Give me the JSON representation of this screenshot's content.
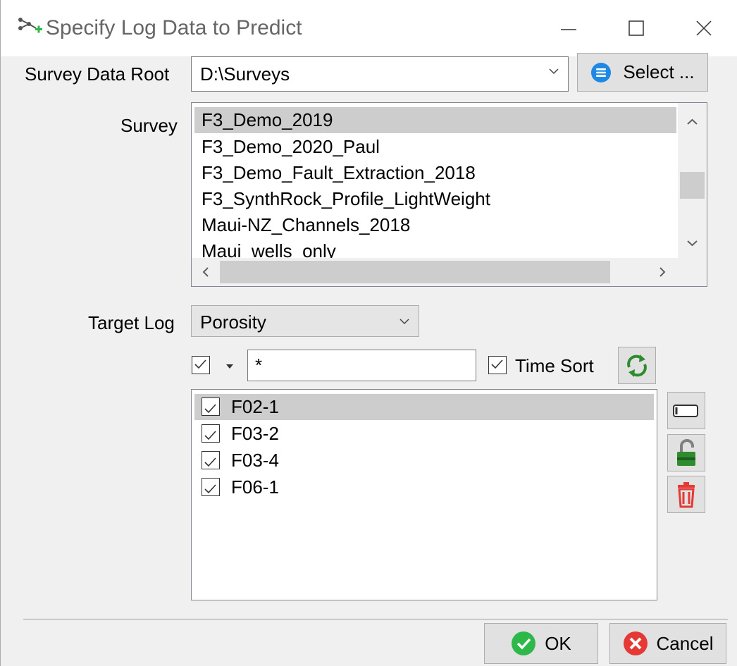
{
  "window": {
    "title": "Specify Log Data to Predict",
    "controls": {
      "minimize": "minimize-icon",
      "maximize": "maximize-icon",
      "close": "close-icon"
    }
  },
  "survey_root": {
    "label": "Survey Data Root",
    "value": "D:\\Surveys",
    "select_button": "Select ..."
  },
  "survey": {
    "label": "Survey",
    "items": [
      "F3_Demo_2019",
      "F3_Demo_2020_Paul",
      "F3_Demo_Fault_Extraction_2018",
      "F3_SynthRock_Profile_LightWeight",
      "Maui-NZ_Channels_2018",
      "Maui_wells_only"
    ],
    "selected_index": 0
  },
  "target_log": {
    "label": "Target Log",
    "value": "Porosity"
  },
  "filter": {
    "value": "*",
    "time_sort_label": "Time Sort",
    "time_sort_checked": true
  },
  "wells": {
    "items": [
      {
        "label": "F02-1",
        "checked": true
      },
      {
        "label": "F03-2",
        "checked": true
      },
      {
        "label": "F03-4",
        "checked": true
      },
      {
        "label": "F06-1",
        "checked": true
      }
    ],
    "selected_index": 0
  },
  "footer": {
    "ok_label": "OK",
    "cancel_label": "Cancel"
  },
  "colors": {
    "accent_blue": "#1e88e5",
    "ok_green": "#2eb84a",
    "cancel_red": "#e53935",
    "selection": "#cdcdcd"
  }
}
